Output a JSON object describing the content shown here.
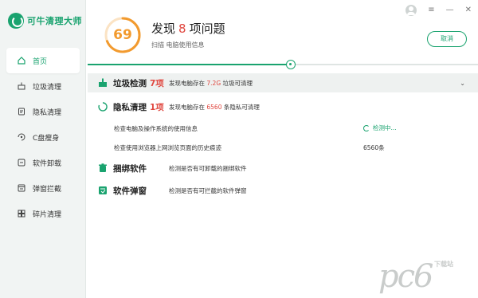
{
  "app": {
    "name": "可牛清理大师"
  },
  "window": {
    "controls": [
      "≡",
      "—",
      "✕"
    ]
  },
  "sidebar": {
    "items": [
      {
        "label": "首页",
        "icon": "home-icon",
        "active": true
      },
      {
        "label": "垃圾清理",
        "icon": "broom-icon"
      },
      {
        "label": "隐私清理",
        "icon": "privacy-icon"
      },
      {
        "label": "C盘瘦身",
        "icon": "disk-icon"
      },
      {
        "label": "软件卸载",
        "icon": "uninstall-icon"
      },
      {
        "label": "弹窗拦截",
        "icon": "popup-icon"
      },
      {
        "label": "碎片清理",
        "icon": "fragment-icon"
      }
    ]
  },
  "header": {
    "score": "69",
    "title_prefix": "发现",
    "title_count": "8",
    "title_suffix": "项问题",
    "subtitle": "扫描 电脑使用信息",
    "cancel_label": "取消"
  },
  "scan": {
    "progress": 0.52
  },
  "categories": [
    {
      "title": "垃圾检测",
      "count": "7项",
      "desc_pre": "发现电脑存在",
      "desc_hl": "7.2G",
      "desc_post": "垃圾可清理",
      "icon": "broom-icon"
    },
    {
      "title": "隐私清理",
      "count": "1项",
      "desc_pre": "发现电脑存在",
      "desc_hl": "6560",
      "desc_post": "条隐私可清理",
      "icon": "loading-icon"
    },
    {
      "title": "捆绑软件",
      "desc": "检测是否有可卸载的捆绑软件",
      "icon": "trash-icon"
    },
    {
      "title": "软件弹窗",
      "desc": "检测是否有可拦截的软件弹窗",
      "icon": "popup-icon"
    }
  ],
  "privacy_items": [
    {
      "label": "检查电脑及操作系统的使用信息",
      "value": "检测中..."
    },
    {
      "label": "检查使用浏览器上网浏览页面的历史痕迹",
      "value": "6560条"
    }
  ],
  "watermark": {
    "big": "pc6",
    "small": "下载站"
  },
  "colors": {
    "accent": "#1aa36f",
    "warn": "#e0463e",
    "score": "#f29a2e"
  }
}
